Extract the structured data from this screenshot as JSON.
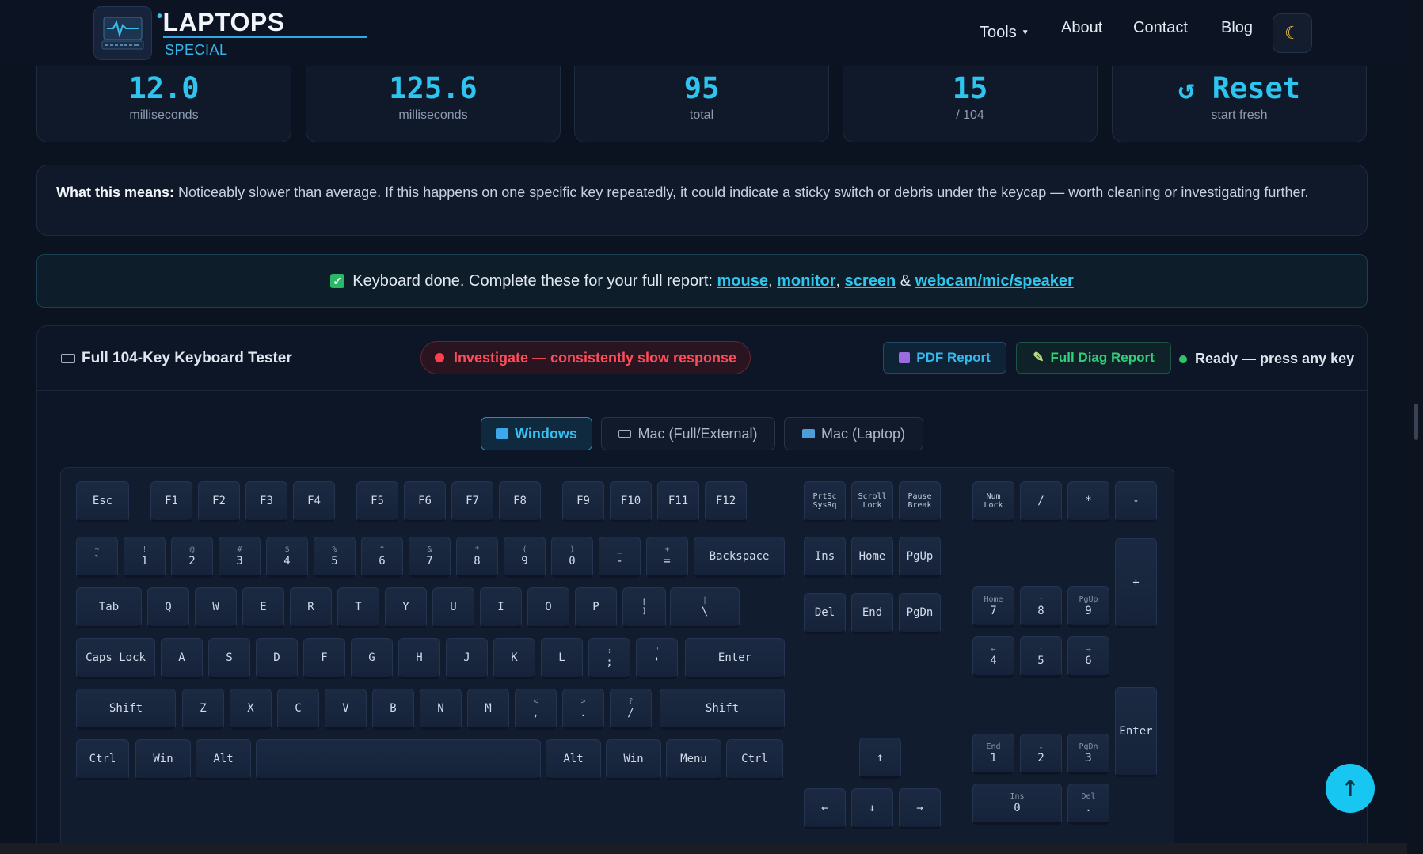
{
  "header": {
    "logo_main": "LAPTOPS",
    "logo_sub": "SPECIAL",
    "nav": [
      "Tools",
      "About",
      "Contact",
      "Blog"
    ],
    "theme_icon": "moon-icon"
  },
  "stats": [
    {
      "value": "12.0",
      "label": "milliseconds"
    },
    {
      "value": "125.6",
      "label": "milliseconds"
    },
    {
      "value": "95",
      "label": "total"
    },
    {
      "value": "15",
      "label": "/ 104"
    },
    {
      "value": "Reset",
      "label": "start fresh",
      "icon": "reset-icon"
    }
  ],
  "meaning": {
    "lead": "What this means:",
    "text": " Noticeably slower than average. If this happens on one specific key repeatedly, it could indicate a sticky switch or debris under the keycap — worth cleaning or investigating further."
  },
  "done_banner": {
    "text": "Keyboard done. Complete these for your full report: ",
    "links": [
      "mouse",
      "monitor",
      "screen",
      "webcam/mic/speaker"
    ],
    "sep1": ", ",
    "sep2": ", ",
    "sep3": " & "
  },
  "tester": {
    "title": "Full 104-Key Keyboard Tester",
    "warning": "Investigate — consistently slow response",
    "pdf_button": "PDF Report",
    "diag_button": "Full Diag Report",
    "status": "Ready — press any key",
    "tabs": [
      "Windows",
      "Mac (Full/External)",
      "Mac (Laptop)"
    ],
    "active_tab": "Windows"
  },
  "keys": {
    "esc": "Esc",
    "f": [
      "F1",
      "F2",
      "F3",
      "F4",
      "F5",
      "F6",
      "F7",
      "F8",
      "F9",
      "F10",
      "F11",
      "F12"
    ],
    "nav_top": [
      [
        "PrtSc",
        "SysRq"
      ],
      [
        "Scroll",
        "Lock"
      ],
      [
        "Pause",
        "Break"
      ]
    ],
    "num_top": [
      [
        "Num",
        "Lock"
      ],
      [
        "",
        "/"
      ],
      [
        "",
        "*"
      ],
      [
        "",
        "-"
      ]
    ],
    "row1": [
      [
        "~",
        "`"
      ],
      [
        "!",
        "1"
      ],
      [
        "@",
        "2"
      ],
      [
        "#",
        "3"
      ],
      [
        "$",
        "4"
      ],
      [
        "%",
        "5"
      ],
      [
        "^",
        "6"
      ],
      [
        "&",
        "7"
      ],
      [
        "*",
        "8"
      ],
      [
        "(",
        "9"
      ],
      [
        ")",
        "0"
      ],
      [
        "_",
        "-"
      ],
      [
        "+",
        "="
      ]
    ],
    "backspace": "Backspace",
    "nav_mid1": [
      "Ins",
      "Home",
      "PgUp"
    ],
    "nav_mid2": [
      "Del",
      "End",
      "PgDn"
    ],
    "tab": "Tab",
    "row2": [
      "Q",
      "W",
      "E",
      "R",
      "T",
      "Y",
      "U",
      "I",
      "O",
      "P"
    ],
    "bracket_open": "[",
    "bracket_close": "]",
    "pipe": [
      "|",
      "\\"
    ],
    "caps": "Caps Lock",
    "row3": [
      "A",
      "S",
      "D",
      "F",
      "G",
      "H",
      "J",
      "K",
      "L"
    ],
    "row3_sym": [
      [
        ":",
        ";"
      ],
      [
        "\"",
        "'"
      ]
    ],
    "enter": "Enter",
    "shift": "Shift",
    "row4": [
      "Z",
      "X",
      "C",
      "V",
      "B",
      "N",
      "M"
    ],
    "row4_sym": [
      [
        "<",
        ","
      ],
      [
        ">",
        "."
      ],
      [
        "?",
        "/"
      ]
    ],
    "bottom_left": [
      "Ctrl",
      "Win",
      "Alt"
    ],
    "bottom_right": [
      "Alt",
      "Win",
      "Menu",
      "Ctrl"
    ],
    "arrows": {
      "up": "↑",
      "left": "←",
      "down": "↓",
      "right": "→"
    },
    "numpad": {
      "r7": [
        [
          "Home",
          "7"
        ],
        [
          "↑",
          "8"
        ],
        [
          "PgUp",
          "9"
        ]
      ],
      "r4": [
        [
          "←",
          "4"
        ],
        [
          "·",
          "5"
        ],
        [
          "→",
          "6"
        ]
      ],
      "r1": [
        [
          "End",
          "1"
        ],
        [
          "↓",
          "2"
        ],
        [
          "PgDn",
          "3"
        ]
      ],
      "ins0": [
        "Ins",
        "0"
      ],
      "del": [
        "Del",
        "."
      ],
      "plus": "+",
      "enter": "Enter"
    }
  },
  "scroll_top_icon": "arrow-up-icon",
  "colors": {
    "accent": "#2ec4f0",
    "danger": "#ff4c5a",
    "success": "#30d07a",
    "bg": "#0b1220"
  }
}
